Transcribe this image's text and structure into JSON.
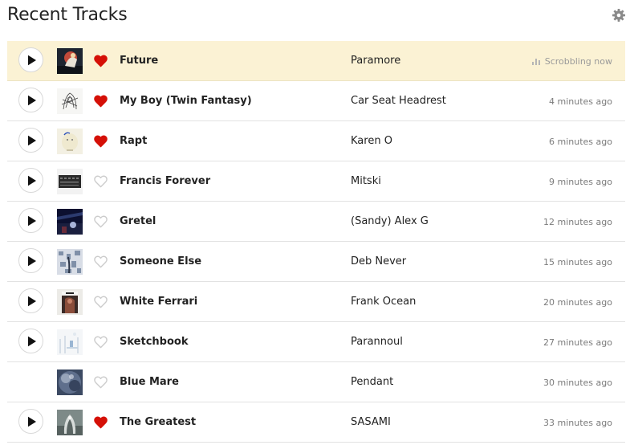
{
  "header": {
    "title": "Recent Tracks",
    "settings_icon": "gear-icon"
  },
  "colors": {
    "now_playing_bg": "#fbf2d4",
    "loved_heart": "#d51007",
    "unloved_heart": "#cccccc",
    "divider": "#e2e2e2"
  },
  "tracks": [
    {
      "name": "Future",
      "artist": "Paramore",
      "time": "Scrobbling now",
      "loved": true,
      "playable": true,
      "now_playing": true,
      "status_icon": "playing-bars-icon"
    },
    {
      "name": "My Boy (Twin Fantasy)",
      "artist": "Car Seat Headrest",
      "time": "4 minutes ago",
      "loved": true,
      "playable": true
    },
    {
      "name": "Rapt",
      "artist": "Karen O",
      "time": "6 minutes ago",
      "loved": true,
      "playable": true
    },
    {
      "name": "Francis Forever",
      "artist": "Mitski",
      "time": "9 minutes ago",
      "loved": false,
      "playable": true
    },
    {
      "name": "Gretel",
      "artist": "(Sandy) Alex G",
      "time": "12 minutes ago",
      "loved": false,
      "playable": true
    },
    {
      "name": "Someone Else",
      "artist": "Deb Never",
      "time": "15 minutes ago",
      "loved": false,
      "playable": true
    },
    {
      "name": "White Ferrari",
      "artist": "Frank Ocean",
      "time": "20 minutes ago",
      "loved": false,
      "playable": true
    },
    {
      "name": "Sketchbook",
      "artist": "Parannoul",
      "time": "27 minutes ago",
      "loved": false,
      "playable": true
    },
    {
      "name": "Blue Mare",
      "artist": "Pendant",
      "time": "30 minutes ago",
      "loved": false,
      "playable": false
    },
    {
      "name": "The Greatest",
      "artist": "SASAMI",
      "time": "33 minutes ago",
      "loved": true,
      "playable": true
    }
  ]
}
